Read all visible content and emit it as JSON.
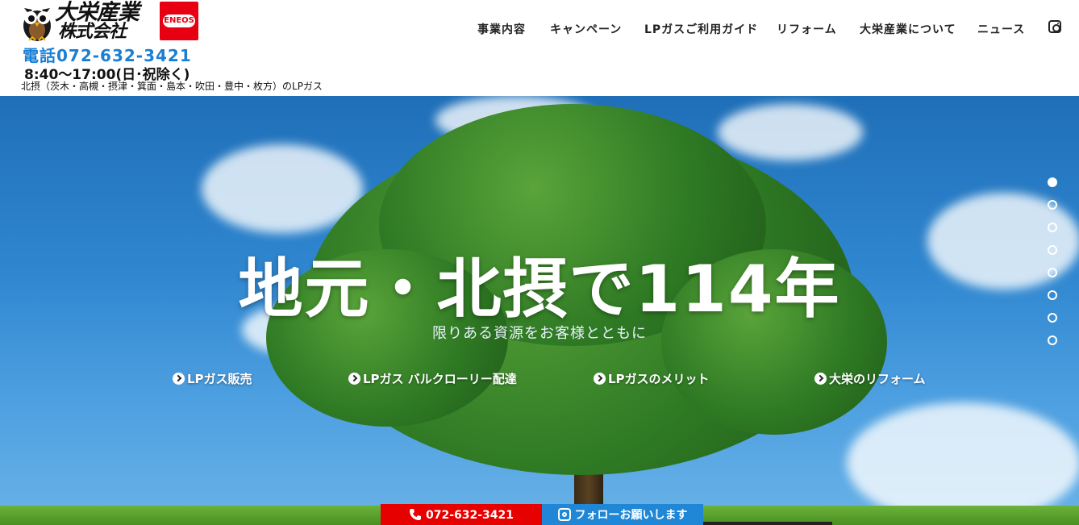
{
  "header": {
    "brand_line1": "大栄産業",
    "brand_line2": "株式会社",
    "eneos_label": "ENEOS",
    "phone": "電話072-632-3421",
    "hours": "8:40～17:00(日･祝除く)",
    "area": "北摂（茨木・高槻・摂津・箕面・島本・吹田・豊中・枚方）のLPガス"
  },
  "nav": {
    "items": [
      {
        "label": "事業内容"
      },
      {
        "label": "キャンペーン"
      },
      {
        "label": "LPガスご利用ガイド"
      },
      {
        "label": "リフォーム"
      },
      {
        "label": "大栄産業について"
      },
      {
        "label": "ニュース"
      }
    ],
    "instagram_icon": "instagram-icon"
  },
  "hero": {
    "title": "地元・北摂で114年",
    "subtitle": "限りある資源をお客様とともに",
    "links": [
      {
        "label": "LPガス販売"
      },
      {
        "label": "LPガス バルクローリー配達"
      },
      {
        "label": "LPガスのメリット"
      },
      {
        "label": "大栄のリフォーム"
      }
    ],
    "slide_count": 8,
    "active_slide": 1
  },
  "cta": {
    "call_label": "072-632-3421",
    "follow_label": "フォローお願いします"
  },
  "colors": {
    "phone_blue": "#1a7fd4",
    "call_red": "#e60000",
    "follow_blue": "#1f87d6",
    "eneos_red": "#e60012"
  }
}
